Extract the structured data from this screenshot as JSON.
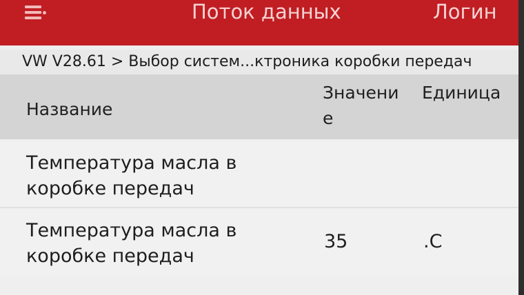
{
  "appbar": {
    "title": "Поток данных",
    "login_label": "Логин",
    "menu_icon": "hamburger-menu-icon"
  },
  "breadcrumb": {
    "text": "VW V28.61 > Выбор систем...ктроника коробки передач"
  },
  "table": {
    "headers": {
      "name": "Название",
      "value": "Значение",
      "unit": "Единица"
    },
    "rows": [
      {
        "name": "Температура масла в коробке передач",
        "value": "",
        "unit": ""
      },
      {
        "name": "Температура масла в коробке передач",
        "value": "35",
        "unit": ".C"
      }
    ]
  },
  "colors": {
    "appbar": "#c01e23",
    "header_bg": "#d4d4d4",
    "row_bg": "#f1f1f1"
  }
}
